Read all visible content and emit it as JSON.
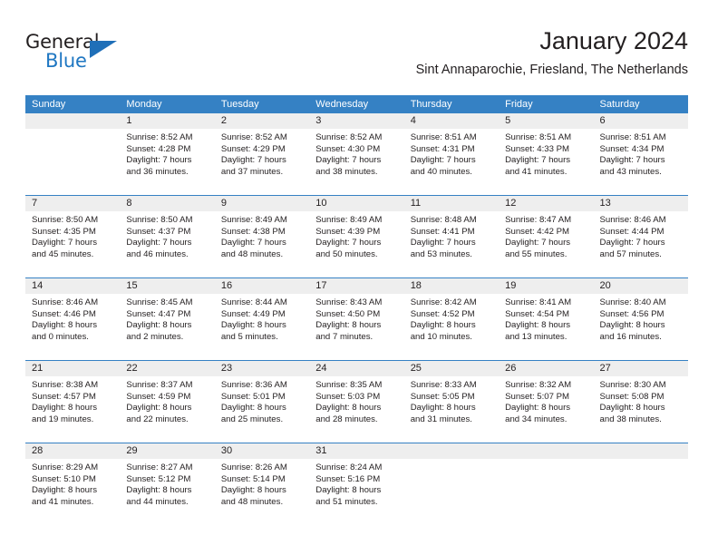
{
  "brand": {
    "name_part1": "General",
    "name_part2": "Blue",
    "accent_color": "#1f6fb8"
  },
  "header": {
    "title": "January 2024",
    "subtitle": "Sint Annaparochie, Friesland, The Netherlands"
  },
  "calendar": {
    "header_bg": "#3581c4",
    "daynum_bg": "#eeeeee",
    "weekdays": [
      "Sunday",
      "Monday",
      "Tuesday",
      "Wednesday",
      "Thursday",
      "Friday",
      "Saturday"
    ],
    "weeks": [
      [
        {
          "day": "",
          "sunrise": "",
          "sunset": "",
          "daylight_line1": "",
          "daylight_line2": ""
        },
        {
          "day": "1",
          "sunrise": "Sunrise: 8:52 AM",
          "sunset": "Sunset: 4:28 PM",
          "daylight_line1": "Daylight: 7 hours",
          "daylight_line2": "and 36 minutes."
        },
        {
          "day": "2",
          "sunrise": "Sunrise: 8:52 AM",
          "sunset": "Sunset: 4:29 PM",
          "daylight_line1": "Daylight: 7 hours",
          "daylight_line2": "and 37 minutes."
        },
        {
          "day": "3",
          "sunrise": "Sunrise: 8:52 AM",
          "sunset": "Sunset: 4:30 PM",
          "daylight_line1": "Daylight: 7 hours",
          "daylight_line2": "and 38 minutes."
        },
        {
          "day": "4",
          "sunrise": "Sunrise: 8:51 AM",
          "sunset": "Sunset: 4:31 PM",
          "daylight_line1": "Daylight: 7 hours",
          "daylight_line2": "and 40 minutes."
        },
        {
          "day": "5",
          "sunrise": "Sunrise: 8:51 AM",
          "sunset": "Sunset: 4:33 PM",
          "daylight_line1": "Daylight: 7 hours",
          "daylight_line2": "and 41 minutes."
        },
        {
          "day": "6",
          "sunrise": "Sunrise: 8:51 AM",
          "sunset": "Sunset: 4:34 PM",
          "daylight_line1": "Daylight: 7 hours",
          "daylight_line2": "and 43 minutes."
        }
      ],
      [
        {
          "day": "7",
          "sunrise": "Sunrise: 8:50 AM",
          "sunset": "Sunset: 4:35 PM",
          "daylight_line1": "Daylight: 7 hours",
          "daylight_line2": "and 45 minutes."
        },
        {
          "day": "8",
          "sunrise": "Sunrise: 8:50 AM",
          "sunset": "Sunset: 4:37 PM",
          "daylight_line1": "Daylight: 7 hours",
          "daylight_line2": "and 46 minutes."
        },
        {
          "day": "9",
          "sunrise": "Sunrise: 8:49 AM",
          "sunset": "Sunset: 4:38 PM",
          "daylight_line1": "Daylight: 7 hours",
          "daylight_line2": "and 48 minutes."
        },
        {
          "day": "10",
          "sunrise": "Sunrise: 8:49 AM",
          "sunset": "Sunset: 4:39 PM",
          "daylight_line1": "Daylight: 7 hours",
          "daylight_line2": "and 50 minutes."
        },
        {
          "day": "11",
          "sunrise": "Sunrise: 8:48 AM",
          "sunset": "Sunset: 4:41 PM",
          "daylight_line1": "Daylight: 7 hours",
          "daylight_line2": "and 53 minutes."
        },
        {
          "day": "12",
          "sunrise": "Sunrise: 8:47 AM",
          "sunset": "Sunset: 4:42 PM",
          "daylight_line1": "Daylight: 7 hours",
          "daylight_line2": "and 55 minutes."
        },
        {
          "day": "13",
          "sunrise": "Sunrise: 8:46 AM",
          "sunset": "Sunset: 4:44 PM",
          "daylight_line1": "Daylight: 7 hours",
          "daylight_line2": "and 57 minutes."
        }
      ],
      [
        {
          "day": "14",
          "sunrise": "Sunrise: 8:46 AM",
          "sunset": "Sunset: 4:46 PM",
          "daylight_line1": "Daylight: 8 hours",
          "daylight_line2": "and 0 minutes."
        },
        {
          "day": "15",
          "sunrise": "Sunrise: 8:45 AM",
          "sunset": "Sunset: 4:47 PM",
          "daylight_line1": "Daylight: 8 hours",
          "daylight_line2": "and 2 minutes."
        },
        {
          "day": "16",
          "sunrise": "Sunrise: 8:44 AM",
          "sunset": "Sunset: 4:49 PM",
          "daylight_line1": "Daylight: 8 hours",
          "daylight_line2": "and 5 minutes."
        },
        {
          "day": "17",
          "sunrise": "Sunrise: 8:43 AM",
          "sunset": "Sunset: 4:50 PM",
          "daylight_line1": "Daylight: 8 hours",
          "daylight_line2": "and 7 minutes."
        },
        {
          "day": "18",
          "sunrise": "Sunrise: 8:42 AM",
          "sunset": "Sunset: 4:52 PM",
          "daylight_line1": "Daylight: 8 hours",
          "daylight_line2": "and 10 minutes."
        },
        {
          "day": "19",
          "sunrise": "Sunrise: 8:41 AM",
          "sunset": "Sunset: 4:54 PM",
          "daylight_line1": "Daylight: 8 hours",
          "daylight_line2": "and 13 minutes."
        },
        {
          "day": "20",
          "sunrise": "Sunrise: 8:40 AM",
          "sunset": "Sunset: 4:56 PM",
          "daylight_line1": "Daylight: 8 hours",
          "daylight_line2": "and 16 minutes."
        }
      ],
      [
        {
          "day": "21",
          "sunrise": "Sunrise: 8:38 AM",
          "sunset": "Sunset: 4:57 PM",
          "daylight_line1": "Daylight: 8 hours",
          "daylight_line2": "and 19 minutes."
        },
        {
          "day": "22",
          "sunrise": "Sunrise: 8:37 AM",
          "sunset": "Sunset: 4:59 PM",
          "daylight_line1": "Daylight: 8 hours",
          "daylight_line2": "and 22 minutes."
        },
        {
          "day": "23",
          "sunrise": "Sunrise: 8:36 AM",
          "sunset": "Sunset: 5:01 PM",
          "daylight_line1": "Daylight: 8 hours",
          "daylight_line2": "and 25 minutes."
        },
        {
          "day": "24",
          "sunrise": "Sunrise: 8:35 AM",
          "sunset": "Sunset: 5:03 PM",
          "daylight_line1": "Daylight: 8 hours",
          "daylight_line2": "and 28 minutes."
        },
        {
          "day": "25",
          "sunrise": "Sunrise: 8:33 AM",
          "sunset": "Sunset: 5:05 PM",
          "daylight_line1": "Daylight: 8 hours",
          "daylight_line2": "and 31 minutes."
        },
        {
          "day": "26",
          "sunrise": "Sunrise: 8:32 AM",
          "sunset": "Sunset: 5:07 PM",
          "daylight_line1": "Daylight: 8 hours",
          "daylight_line2": "and 34 minutes."
        },
        {
          "day": "27",
          "sunrise": "Sunrise: 8:30 AM",
          "sunset": "Sunset: 5:08 PM",
          "daylight_line1": "Daylight: 8 hours",
          "daylight_line2": "and 38 minutes."
        }
      ],
      [
        {
          "day": "28",
          "sunrise": "Sunrise: 8:29 AM",
          "sunset": "Sunset: 5:10 PM",
          "daylight_line1": "Daylight: 8 hours",
          "daylight_line2": "and 41 minutes."
        },
        {
          "day": "29",
          "sunrise": "Sunrise: 8:27 AM",
          "sunset": "Sunset: 5:12 PM",
          "daylight_line1": "Daylight: 8 hours",
          "daylight_line2": "and 44 minutes."
        },
        {
          "day": "30",
          "sunrise": "Sunrise: 8:26 AM",
          "sunset": "Sunset: 5:14 PM",
          "daylight_line1": "Daylight: 8 hours",
          "daylight_line2": "and 48 minutes."
        },
        {
          "day": "31",
          "sunrise": "Sunrise: 8:24 AM",
          "sunset": "Sunset: 5:16 PM",
          "daylight_line1": "Daylight: 8 hours",
          "daylight_line2": "and 51 minutes."
        },
        {
          "day": "",
          "sunrise": "",
          "sunset": "",
          "daylight_line1": "",
          "daylight_line2": ""
        },
        {
          "day": "",
          "sunrise": "",
          "sunset": "",
          "daylight_line1": "",
          "daylight_line2": ""
        },
        {
          "day": "",
          "sunrise": "",
          "sunset": "",
          "daylight_line1": "",
          "daylight_line2": ""
        }
      ]
    ]
  }
}
